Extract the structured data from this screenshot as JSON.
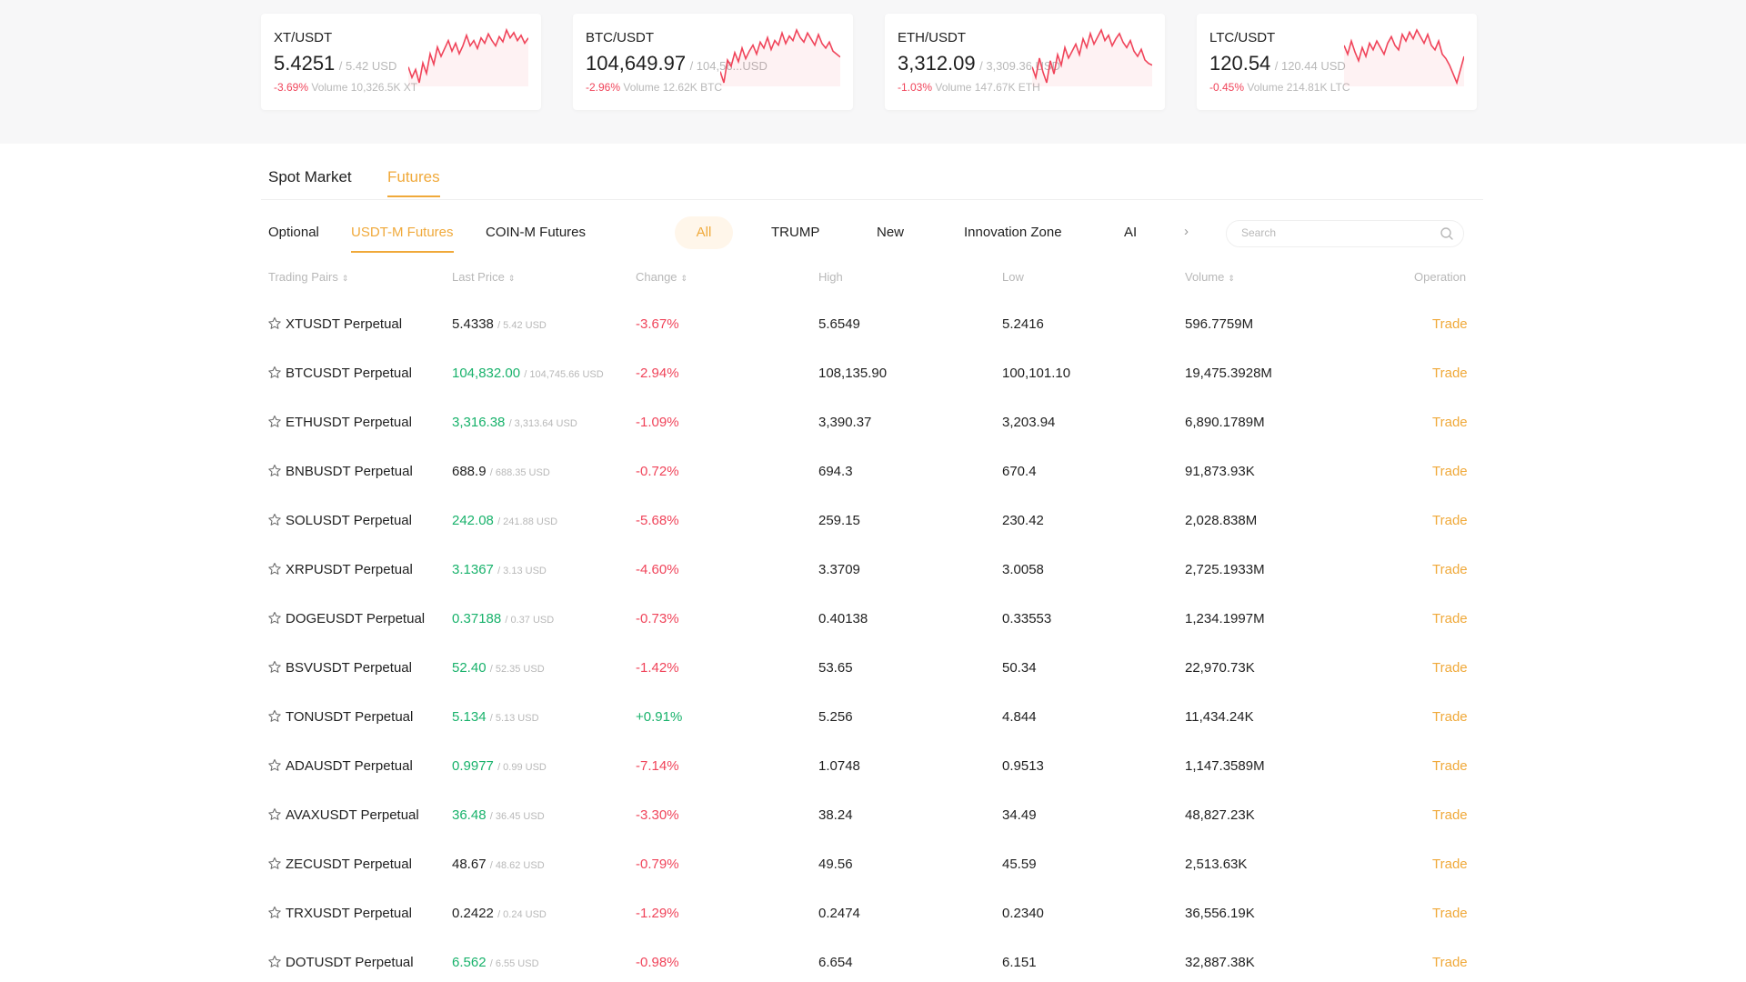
{
  "tickers": [
    {
      "pair": "XT/USDT",
      "price": "5.4251",
      "usd": "/ 5.42 USD",
      "change": "-3.69%",
      "volume": "Volume 10,326.5K XT",
      "spark": [
        60,
        52,
        58,
        48,
        63,
        55,
        70,
        62,
        75,
        68,
        74,
        80,
        72,
        78,
        70,
        76,
        84,
        76,
        80,
        74,
        82,
        78,
        85,
        80,
        76,
        83,
        79,
        88,
        82,
        86,
        80,
        84,
        78,
        82
      ]
    },
    {
      "pair": "BTC/USDT",
      "price": "104,649.97",
      "usd": "/ 104,56...USD",
      "change": "-2.96%",
      "volume": "Volume 12.62K BTC",
      "spark": [
        35,
        20,
        50,
        42,
        60,
        48,
        66,
        52,
        62,
        70,
        58,
        74,
        66,
        80,
        64,
        76,
        70,
        86,
        72,
        82,
        76,
        90,
        80,
        74,
        86,
        78,
        70,
        84,
        72,
        66,
        74,
        62,
        58,
        54
      ]
    },
    {
      "pair": "ETH/USDT",
      "price": "3,312.09",
      "usd": "/ 3,309.36 USD",
      "change": "-1.03%",
      "volume": "Volume 147.67K ETH",
      "spark": [
        48,
        36,
        58,
        42,
        30,
        55,
        40,
        62,
        50,
        70,
        58,
        66,
        74,
        62,
        80,
        70,
        86,
        74,
        82,
        90,
        78,
        84,
        72,
        80,
        86,
        76,
        70,
        78,
        66,
        60,
        68,
        56,
        52,
        50
      ]
    },
    {
      "pair": "LTC/USDT",
      "price": "120.54",
      "usd": "/ 120.44 USD",
      "change": "-0.45%",
      "volume": "Volume 214.81K LTC",
      "spark": [
        62,
        54,
        66,
        56,
        48,
        60,
        52,
        64,
        58,
        66,
        60,
        54,
        64,
        70,
        62,
        58,
        72,
        66,
        74,
        68,
        76,
        70,
        64,
        72,
        62,
        58,
        66,
        54,
        50,
        44,
        36,
        28,
        40,
        52
      ]
    }
  ],
  "main_tabs": [
    "Spot Market",
    "Futures"
  ],
  "sub_tabs": [
    "Optional",
    "USDT-M Futures",
    "COIN-M Futures"
  ],
  "filters": [
    "All",
    "TRUMP",
    "New",
    "Innovation Zone",
    "AI"
  ],
  "search": {
    "placeholder": "Search"
  },
  "columns": [
    "Trading Pairs",
    "Last Price",
    "Change",
    "High",
    "Low",
    "Volume",
    "Operation"
  ],
  "colors": {
    "accent": "#f0a93a",
    "up": "#18b26b",
    "down": "#f0445a"
  },
  "rows": [
    {
      "pair": "XTUSDT Perpetual",
      "price": "5.4338",
      "price_usd": "/ 5.42 USD",
      "price_dir": "neutral",
      "change": "-3.67%",
      "high": "5.6549",
      "low": "5.2416",
      "volume": "596.7759M",
      "action": "Trade"
    },
    {
      "pair": "BTCUSDT Perpetual",
      "price": "104,832.00",
      "price_usd": "/ 104,745.66 USD",
      "price_dir": "up",
      "change": "-2.94%",
      "high": "108,135.90",
      "low": "100,101.10",
      "volume": "19,475.3928M",
      "action": "Trade"
    },
    {
      "pair": "ETHUSDT Perpetual",
      "price": "3,316.38",
      "price_usd": "/ 3,313.64 USD",
      "price_dir": "up",
      "change": "-1.09%",
      "high": "3,390.37",
      "low": "3,203.94",
      "volume": "6,890.1789M",
      "action": "Trade"
    },
    {
      "pair": "BNBUSDT Perpetual",
      "price": "688.9",
      "price_usd": "/ 688.35 USD",
      "price_dir": "neutral",
      "change": "-0.72%",
      "high": "694.3",
      "low": "670.4",
      "volume": "91,873.93K",
      "action": "Trade"
    },
    {
      "pair": "SOLUSDT Perpetual",
      "price": "242.08",
      "price_usd": "/ 241.88 USD",
      "price_dir": "up",
      "change": "-5.68%",
      "high": "259.15",
      "low": "230.42",
      "volume": "2,028.838M",
      "action": "Trade"
    },
    {
      "pair": "XRPUSDT Perpetual",
      "price": "3.1367",
      "price_usd": "/ 3.13 USD",
      "price_dir": "up",
      "change": "-4.60%",
      "high": "3.3709",
      "low": "3.0058",
      "volume": "2,725.1933M",
      "action": "Trade"
    },
    {
      "pair": "DOGEUSDT Perpetual",
      "price": "0.37188",
      "price_usd": "/ 0.37 USD",
      "price_dir": "up",
      "change": "-0.73%",
      "high": "0.40138",
      "low": "0.33553",
      "volume": "1,234.1997M",
      "action": "Trade"
    },
    {
      "pair": "BSVUSDT Perpetual",
      "price": "52.40",
      "price_usd": "/ 52.35 USD",
      "price_dir": "up",
      "change": "-1.42%",
      "high": "53.65",
      "low": "50.34",
      "volume": "22,970.73K",
      "action": "Trade"
    },
    {
      "pair": "TONUSDT Perpetual",
      "price": "5.134",
      "price_usd": "/ 5.13 USD",
      "price_dir": "up",
      "change": "+0.91%",
      "high": "5.256",
      "low": "4.844",
      "volume": "11,434.24K",
      "action": "Trade"
    },
    {
      "pair": "ADAUSDT Perpetual",
      "price": "0.9977",
      "price_usd": "/ 0.99 USD",
      "price_dir": "up",
      "change": "-7.14%",
      "high": "1.0748",
      "low": "0.9513",
      "volume": "1,147.3589M",
      "action": "Trade"
    },
    {
      "pair": "AVAXUSDT Perpetual",
      "price": "36.48",
      "price_usd": "/ 36.45 USD",
      "price_dir": "up",
      "change": "-3.30%",
      "high": "38.24",
      "low": "34.49",
      "volume": "48,827.23K",
      "action": "Trade"
    },
    {
      "pair": "ZECUSDT Perpetual",
      "price": "48.67",
      "price_usd": "/ 48.62 USD",
      "price_dir": "neutral",
      "change": "-0.79%",
      "high": "49.56",
      "low": "45.59",
      "volume": "2,513.63K",
      "action": "Trade"
    },
    {
      "pair": "TRXUSDT Perpetual",
      "price": "0.2422",
      "price_usd": "/ 0.24 USD",
      "price_dir": "neutral",
      "change": "-1.29%",
      "high": "0.2474",
      "low": "0.2340",
      "volume": "36,556.19K",
      "action": "Trade"
    },
    {
      "pair": "DOTUSDT Perpetual",
      "price": "6.562",
      "price_usd": "/ 6.55 USD",
      "price_dir": "up",
      "change": "-0.98%",
      "high": "6.654",
      "low": "6.151",
      "volume": "32,887.38K",
      "action": "Trade"
    }
  ]
}
